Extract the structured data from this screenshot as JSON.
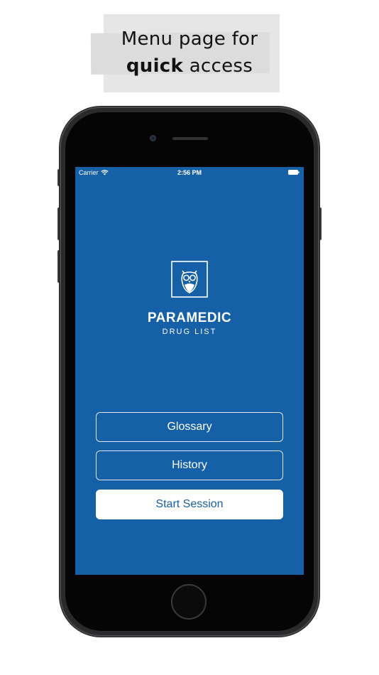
{
  "caption": {
    "line1": "Menu page for",
    "line2_bold": "quick",
    "line2_rest": " access"
  },
  "status_bar": {
    "carrier": "Carrier",
    "time": "2:56 PM"
  },
  "app": {
    "logo_icon": "owl-logo-icon",
    "title": "PARAMEDIC",
    "subtitle": "DRUG LIST"
  },
  "menu": {
    "glossary_label": "Glossary",
    "history_label": "History",
    "start_session_label": "Start Session"
  },
  "colors": {
    "screen_bg": "#1660a8",
    "primary_button_bg": "#ffffff",
    "primary_button_text": "#1660a8"
  }
}
